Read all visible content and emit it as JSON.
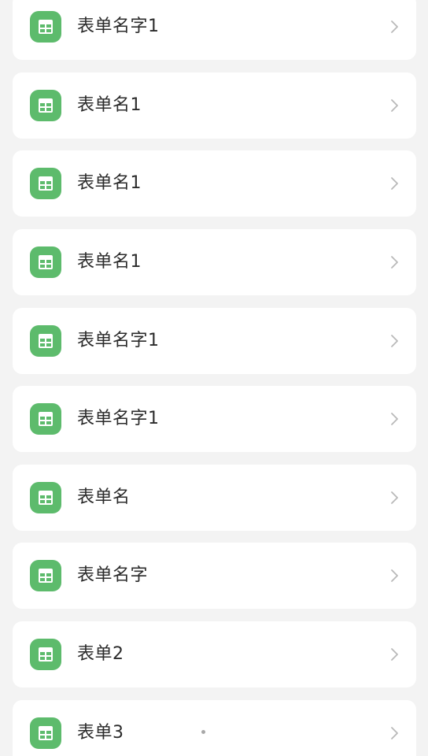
{
  "colors": {
    "background": "#f3f3f3",
    "card": "#ffffff",
    "icon_bg": "#5dbb6c",
    "text": "#2b2b2b",
    "chevron": "#b9b9b9"
  },
  "list": {
    "items": [
      {
        "label": "表单名字1",
        "icon": "table-icon"
      },
      {
        "label": "表单名1",
        "icon": "table-icon"
      },
      {
        "label": "表单名1",
        "icon": "table-icon"
      },
      {
        "label": "表单名1",
        "icon": "table-icon"
      },
      {
        "label": "表单名字1",
        "icon": "table-icon"
      },
      {
        "label": "表单名字1",
        "icon": "table-icon"
      },
      {
        "label": "表单名",
        "icon": "table-icon"
      },
      {
        "label": "表单名字",
        "icon": "table-icon"
      },
      {
        "label": "表单2",
        "icon": "table-icon"
      },
      {
        "label": "表单3",
        "icon": "table-icon"
      }
    ]
  }
}
